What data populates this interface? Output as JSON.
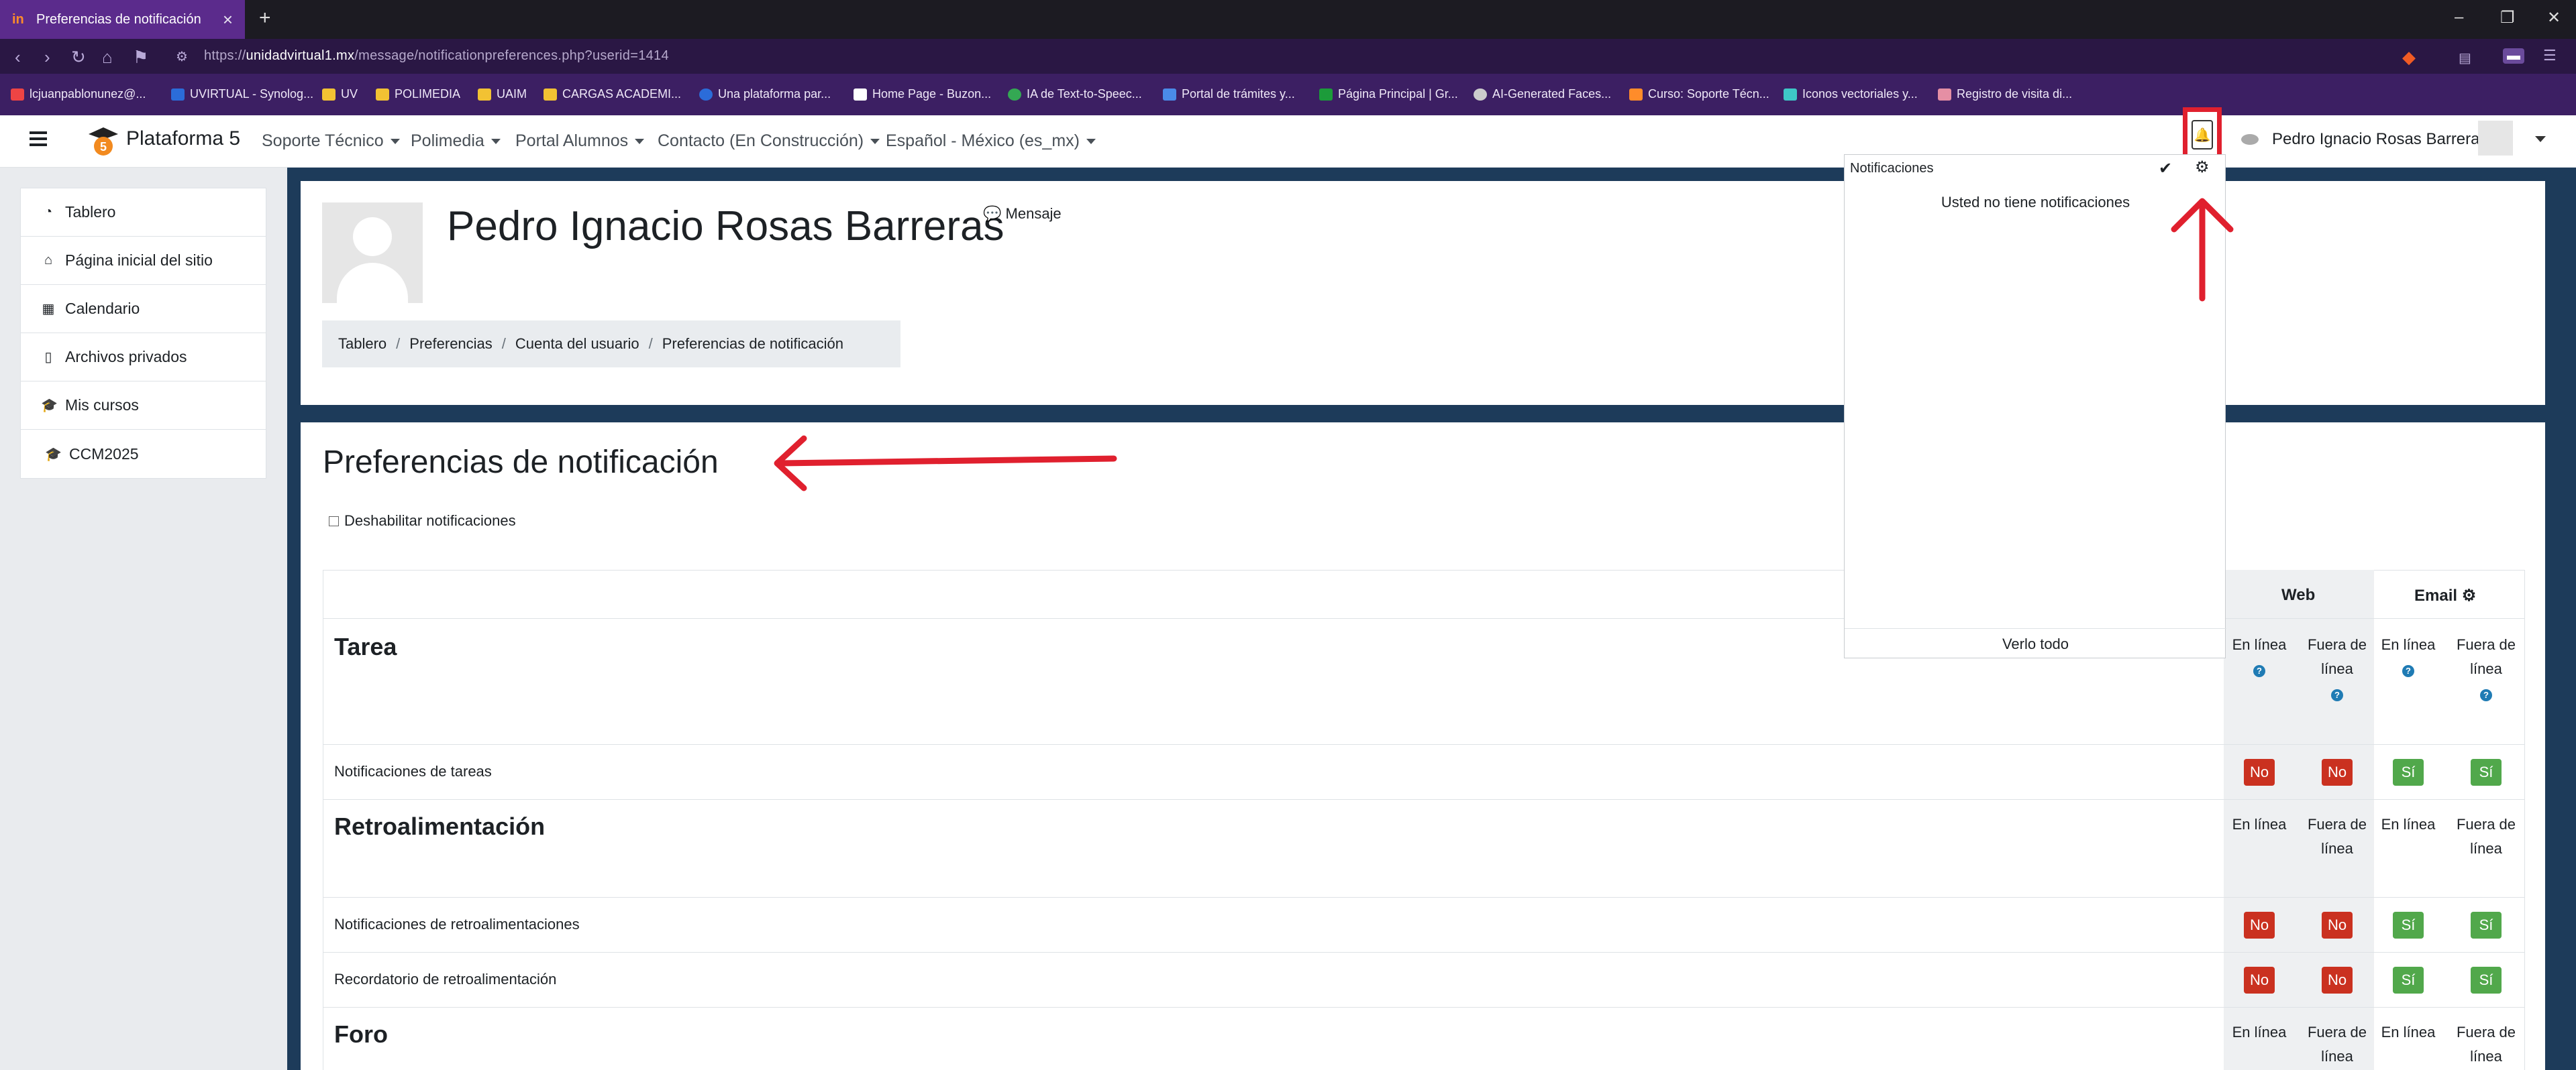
{
  "browser": {
    "tab_title": "Preferencias de notificación",
    "url_prefix": "https://",
    "url_host": "unidadvirtual1.mx",
    "url_path": "/message/notificationpreferences.php?userid=1414",
    "bookmarks": [
      "lcjuanpablonunez@...",
      "UVIRTUAL - Synolog...",
      "UV",
      "POLIMEDIA",
      "UAIM",
      "CARGAS ACADEMI...",
      "Una plataforma par...",
      "Home Page - Buzon...",
      "IA de Text-to-Speec...",
      "Portal de trámites y...",
      "Página Principal | Gr...",
      "AI-Generated Faces...",
      "Curso: Soporte Técn...",
      "Iconos vectoriales y...",
      "Registro de visita di..."
    ]
  },
  "navbar": {
    "brand": "Plataforma 5",
    "menus": [
      "Soporte Técnico",
      "Polimedia",
      "Portal Alumnos",
      "Contacto (En Construcción)",
      "Español - México (es_mx)"
    ],
    "username": "Pedro Ignacio Rosas Barreras"
  },
  "leftnav": {
    "items": [
      {
        "label": "Tablero",
        "icon": "dashboard-icon"
      },
      {
        "label": "Página inicial del sitio",
        "icon": "home-icon"
      },
      {
        "label": "Calendario",
        "icon": "calendar-icon"
      },
      {
        "label": "Archivos privados",
        "icon": "file-icon"
      },
      {
        "label": "Mis cursos",
        "icon": "graduation-cap-icon"
      },
      {
        "label": "CCM2025",
        "icon": "graduation-cap-icon"
      }
    ]
  },
  "header": {
    "name": "Pedro Ignacio Rosas Barreras",
    "message_link": "Mensaje",
    "breadcrumb": [
      "Tablero",
      "Preferencias",
      "Cuenta del usuario",
      "Preferencias de notificación"
    ]
  },
  "main": {
    "title": "Preferencias de notificación",
    "disable_label": "Deshabilitar notificaciones",
    "col_web": "Web",
    "col_email": "Email",
    "online": "En línea",
    "offline": "Fuera de línea",
    "sections": [
      {
        "title": "Tarea",
        "rows": [
          {
            "label": "Notificaciones de tareas",
            "web_online": "No",
            "web_offline": "No",
            "email_online": "Sí",
            "email_offline": "Sí"
          }
        ]
      },
      {
        "title": "Retroalimentación",
        "rows": [
          {
            "label": "Notificaciones de retroalimentaciones",
            "web_online": "No",
            "web_offline": "No",
            "email_online": "Sí",
            "email_offline": "Sí"
          },
          {
            "label": "Recordatorio de retroalimentación",
            "web_online": "No",
            "web_offline": "No",
            "email_online": "Sí",
            "email_offline": "Sí"
          }
        ]
      },
      {
        "title": "Foro",
        "rows": []
      }
    ]
  },
  "popover": {
    "title": "Notificaciones",
    "empty_text": "Usted no tiene notificaciones",
    "footer": "Verlo todo"
  },
  "colors": {
    "no": "#ca3120",
    "si": "#51a84b",
    "annotation": "#e0202e",
    "tab": "#5b2b8c"
  }
}
